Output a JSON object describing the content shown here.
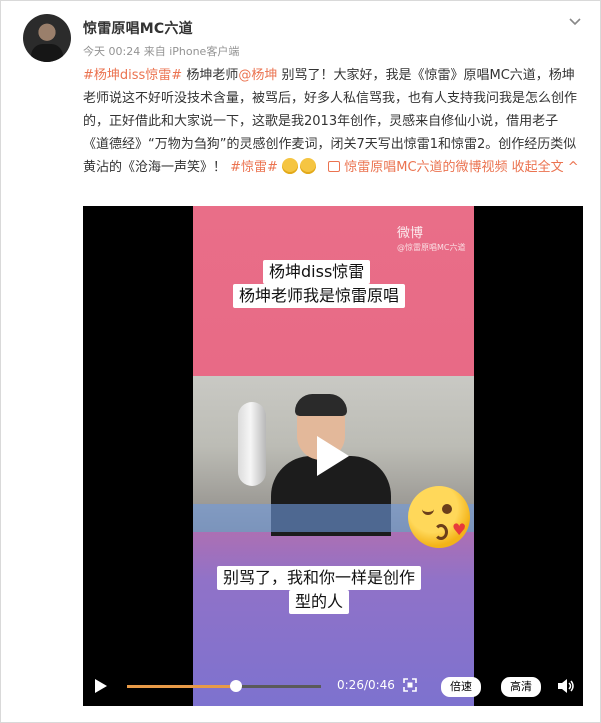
{
  "post": {
    "username": "惊雷原唱MC六道",
    "meta": "今天 00:24 来自 iPhone客户端",
    "content": {
      "topic1": "#杨坤diss惊雷#",
      "text1": " 杨坤老师",
      "mention": "@杨坤",
      "text2": " 别骂了！大家好，我是《惊雷》原唱MC六道，杨坤老师说这不好听没技术含量，被骂后，好多人私信骂我，也有人支持我问我是怎么创作的，正好借此和大家说一下，这歌是我2013年创作，灵感来自修仙小说，借用老子《道德经》“万物为刍狗”的灵感创作麦词，闭关7天写出惊雷1和惊雷2。创作经历类似黄沾的《沧海一声笑》！",
      "topic2": "#惊雷#",
      "video_link": "惊雷原唱MC六道的微博视频",
      "collapse": "收起全文 ^"
    }
  },
  "video": {
    "watermark": "微博",
    "watermark_sub": "@惊雷原唱MC六道",
    "caption_top_line1": "杨坤diss惊雷",
    "caption_top_line2": "杨坤老师我是惊雷原唱",
    "caption_bottom_line1": "别骂了，我和你一样是创作",
    "caption_bottom_line2": "型的人",
    "time": "0:26/0:46",
    "progress": 0.565,
    "speed_label": "倍速",
    "quality_label": "高清"
  },
  "icons": {
    "chevron": "chevron-down-icon",
    "play": "play-icon",
    "fullscreen": "fullscreen-icon",
    "volume": "volume-icon",
    "emoji": "smile-emoji-icon",
    "video_tag": "video-link-icon"
  },
  "colors": {
    "link": "#eb7350",
    "progress": "#e89a48"
  }
}
